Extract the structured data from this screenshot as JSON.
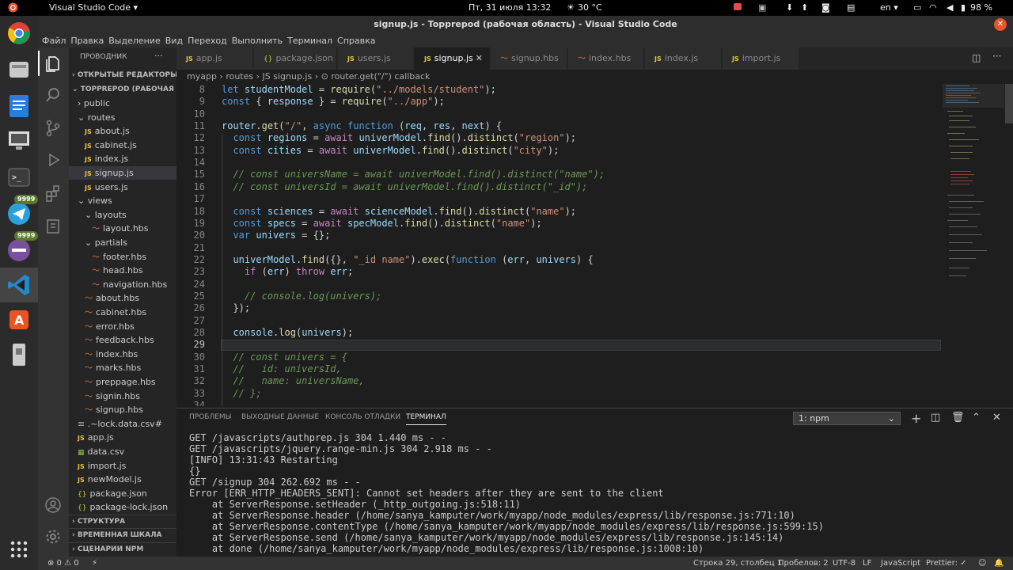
{
  "topbar": {
    "activities": "Обзор",
    "app": "Visual Studio Code ▾",
    "clock": "Пт, 31 июля  13:32",
    "weather": "30 °C",
    "lang": "en ▾",
    "battery": "98 %"
  },
  "window": {
    "title": "signup.js - Topprepod (рабочая область) - Visual Studio Code"
  },
  "menu": [
    "Файл",
    "Правка",
    "Выделение",
    "Вид",
    "Переход",
    "Выполнить",
    "Терминал",
    "Справка"
  ],
  "dock": {
    "badge1": "9999",
    "badge2": "9999"
  },
  "sidebar": {
    "title": "ПРОВОДНИК",
    "open_editors": "ОТКРЫТЫЕ РЕДАКТОРЫ",
    "workspace": "TOPPREPOD (РАБОЧАЯ О...",
    "tree": [
      {
        "label": "public",
        "type": "folder",
        "indent": 1
      },
      {
        "label": "routes",
        "type": "folder-open",
        "indent": 1
      },
      {
        "label": "about.js",
        "type": "js",
        "indent": 2
      },
      {
        "label": "cabinet.js",
        "type": "js",
        "indent": 2
      },
      {
        "label": "index.js",
        "type": "js",
        "indent": 2
      },
      {
        "label": "signup.js",
        "type": "js",
        "indent": 2,
        "selected": true
      },
      {
        "label": "users.js",
        "type": "js",
        "indent": 2
      },
      {
        "label": "views",
        "type": "folder-open",
        "indent": 1
      },
      {
        "label": "layouts",
        "type": "folder-open",
        "indent": 2
      },
      {
        "label": "layout.hbs",
        "type": "hbs",
        "indent": 3
      },
      {
        "label": "partials",
        "type": "folder-open",
        "indent": 2
      },
      {
        "label": "footer.hbs",
        "type": "hbs",
        "indent": 3
      },
      {
        "label": "head.hbs",
        "type": "hbs",
        "indent": 3
      },
      {
        "label": "navigation.hbs",
        "type": "hbs",
        "indent": 3
      },
      {
        "label": "about.hbs",
        "type": "hbs",
        "indent": 2
      },
      {
        "label": "cabinet.hbs",
        "type": "hbs",
        "indent": 2
      },
      {
        "label": "error.hbs",
        "type": "hbs",
        "indent": 2
      },
      {
        "label": "feedback.hbs",
        "type": "hbs",
        "indent": 2
      },
      {
        "label": "index.hbs",
        "type": "hbs",
        "indent": 2
      },
      {
        "label": "marks.hbs",
        "type": "hbs",
        "indent": 2
      },
      {
        "label": "preppage.hbs",
        "type": "hbs",
        "indent": 2
      },
      {
        "label": "signin.hbs",
        "type": "hbs",
        "indent": 2
      },
      {
        "label": "signup.hbs",
        "type": "hbs",
        "indent": 2
      },
      {
        "label": ".~lock.data.csv#",
        "type": "file",
        "indent": 1
      },
      {
        "label": "app.js",
        "type": "js",
        "indent": 1
      },
      {
        "label": "data.csv",
        "type": "csv",
        "indent": 1
      },
      {
        "label": "import.js",
        "type": "js",
        "indent": 1
      },
      {
        "label": "newModel.js",
        "type": "js",
        "indent": 1
      },
      {
        "label": "package.json",
        "type": "json",
        "indent": 1
      },
      {
        "label": "package-lock.json",
        "type": "json",
        "indent": 1
      }
    ],
    "structure": "СТРУКТУРА",
    "timeline": "ВРЕМЕННАЯ ШКАЛА",
    "npm": "СЦЕНАРИИ NPM"
  },
  "tabs": [
    {
      "label": "app.js",
      "type": "js"
    },
    {
      "label": "package.json",
      "type": "json"
    },
    {
      "label": "users.js",
      "type": "js"
    },
    {
      "label": "signup.js",
      "type": "js",
      "active": true
    },
    {
      "label": "signup.hbs",
      "type": "hbs"
    },
    {
      "label": "index.hbs",
      "type": "hbs"
    },
    {
      "label": "index.js",
      "type": "js"
    },
    {
      "label": "import.js",
      "type": "js"
    }
  ],
  "breadcrumb": "myapp  ›  routes  ›  JS signup.js  ›  ⊙ router.get(\"/\") callback",
  "editor": {
    "current_line": 29,
    "lines": [
      {
        "n": "8",
        "html": "<span class=\"kw\">let</span> <span class=\"var\">studentModel</span> = <span class=\"fn\">require</span>(<span class=\"str\">\"../models/student\"</span>);"
      },
      {
        "n": "9",
        "html": "<span class=\"kw\">const</span> { <span class=\"var\">response</span> } = <span class=\"fn\">require</span>(<span class=\"str\">\"../app\"</span>);"
      },
      {
        "n": "10",
        "html": ""
      },
      {
        "n": "11",
        "html": "<span class=\"var\">router</span>.<span class=\"fn\">get</span>(<span class=\"str\">\"/\"</span>, <span class=\"kw\">async</span> <span class=\"kw\">function</span> (<span class=\"var\">req</span>, <span class=\"var\">res</span>, <span class=\"var\">next</span>) {"
      },
      {
        "n": "12",
        "html": "  <span class=\"kw\">const</span> <span class=\"var\">regions</span> = <span class=\"ctl\">await</span> <span class=\"var\">univerModel</span>.<span class=\"fn\">find</span>().<span class=\"fn\">distinct</span>(<span class=\"str\">\"region\"</span>);"
      },
      {
        "n": "13",
        "html": "  <span class=\"kw\">const</span> <span class=\"var\">cities</span> = <span class=\"ctl\">await</span> <span class=\"var\">univerModel</span>.<span class=\"fn\">find</span>().<span class=\"fn\">distinct</span>(<span class=\"str\">\"city\"</span>);"
      },
      {
        "n": "14",
        "html": ""
      },
      {
        "n": "15",
        "html": "  <span class=\"cm\">// const universName = await univerModel.find().distinct(\"name\");</span>"
      },
      {
        "n": "16",
        "html": "  <span class=\"cm\">// const universId = await univerModel.find().distinct(\"_id\");</span>"
      },
      {
        "n": "17",
        "html": ""
      },
      {
        "n": "18",
        "html": "  <span class=\"kw\">const</span> <span class=\"var\">sciences</span> = <span class=\"ctl\">await</span> <span class=\"var\">scienceModel</span>.<span class=\"fn\">find</span>().<span class=\"fn\">distinct</span>(<span class=\"str\">\"name\"</span>);"
      },
      {
        "n": "19",
        "html": "  <span class=\"kw\">const</span> <span class=\"var\">specs</span> = <span class=\"ctl\">await</span> <span class=\"var\">specModel</span>.<span class=\"fn\">find</span>().<span class=\"fn\">distinct</span>(<span class=\"str\">\"name\"</span>);"
      },
      {
        "n": "20",
        "html": "  <span class=\"kw\">var</span> <span class=\"var\">univers</span> = {};"
      },
      {
        "n": "21",
        "html": ""
      },
      {
        "n": "22",
        "html": "  <span class=\"var\">univerModel</span>.<span class=\"fn\">find</span>({}, <span class=\"str\">\"_id name\"</span>).<span class=\"fn\">exec</span>(<span class=\"kw\">function</span> (<span class=\"var\">err</span>, <span class=\"var\">univers</span>) {"
      },
      {
        "n": "23",
        "html": "    <span class=\"ctl\">if</span> (<span class=\"var\">err</span>) <span class=\"ctl\">throw</span> <span class=\"var\">err</span>;"
      },
      {
        "n": "24",
        "html": ""
      },
      {
        "n": "25",
        "html": "    <span class=\"cm\">// console.log(univers);</span>"
      },
      {
        "n": "26",
        "html": "  });"
      },
      {
        "n": "27",
        "html": ""
      },
      {
        "n": "28",
        "html": "  <span class=\"var\">console</span>.<span class=\"fn\">log</span>(<span class=\"var\">univers</span>);"
      },
      {
        "n": "29",
        "html": ""
      },
      {
        "n": "30",
        "html": "  <span class=\"cm\">// const univers = {</span>"
      },
      {
        "n": "31",
        "html": "  <span class=\"cm\">//   id: universId,</span>"
      },
      {
        "n": "32",
        "html": "  <span class=\"cm\">//   name: universName,</span>"
      },
      {
        "n": "33",
        "html": "  <span class=\"cm\">// };</span>"
      },
      {
        "n": "34",
        "html": ""
      }
    ]
  },
  "panel": {
    "tabs": [
      "ПРОБЛЕМЫ",
      "ВЫХОДНЫЕ ДАННЫЕ",
      "КОНСОЛЬ ОТЛАДКИ",
      "ТЕРМИНАЛ"
    ],
    "active_tab": 3,
    "terminal_select": "1: npm",
    "terminal_lines": [
      "GET /javascripts/authprep.js 304 1.440 ms - -",
      "GET /javascripts/jquery.range-min.js 304 2.918 ms - -",
      "[INFO] 13:31:43 Restarting",
      "{}",
      "GET /signup 304 262.692 ms - -",
      "Error [ERR_HTTP_HEADERS_SENT]: Cannot set headers after they are sent to the client",
      "    at ServerResponse.setHeader (_http_outgoing.js:518:11)",
      "    at ServerResponse.header (/home/sanya_kamputer/work/myapp/node_modules/express/lib/response.js:771:10)",
      "    at ServerResponse.contentType (/home/sanya_kamputer/work/myapp/node_modules/express/lib/response.js:599:15)",
      "    at ServerResponse.send (/home/sanya_kamputer/work/myapp/node_modules/express/lib/response.js:145:14)",
      "    at done (/home/sanya_kamputer/work/myapp/node_modules/express/lib/response.js:1008:10)"
    ]
  },
  "status": {
    "errors": "⊗ 0 ⚠ 0",
    "position": "Строка 29, столбец 1",
    "spaces": "Пробелов: 2",
    "encoding": "UTF-8",
    "eol": "LF",
    "language": "JavaScript",
    "prettier": "Prettier: ✓"
  },
  "colors": {
    "accent": "#007acc",
    "selected_tab": "#1e1e1e",
    "editor_bg": "#1e1e1e"
  }
}
